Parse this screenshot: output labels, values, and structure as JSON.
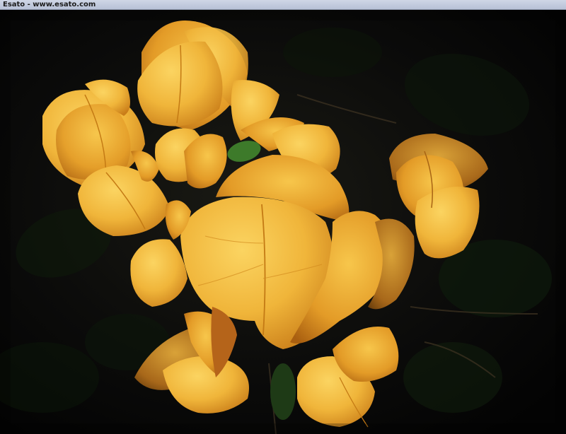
{
  "window": {
    "title": "Esato - www.esato.com"
  },
  "photo": {
    "subject": "yellow-orange bougainvillea bracts on dark foliage",
    "colors": {
      "background": "#050505",
      "bract_light": "#f6c84c",
      "bract_mid": "#e8a52a",
      "bract_shadow": "#b86a12",
      "vein": "#c47a14",
      "foliage": "#14240f"
    }
  }
}
